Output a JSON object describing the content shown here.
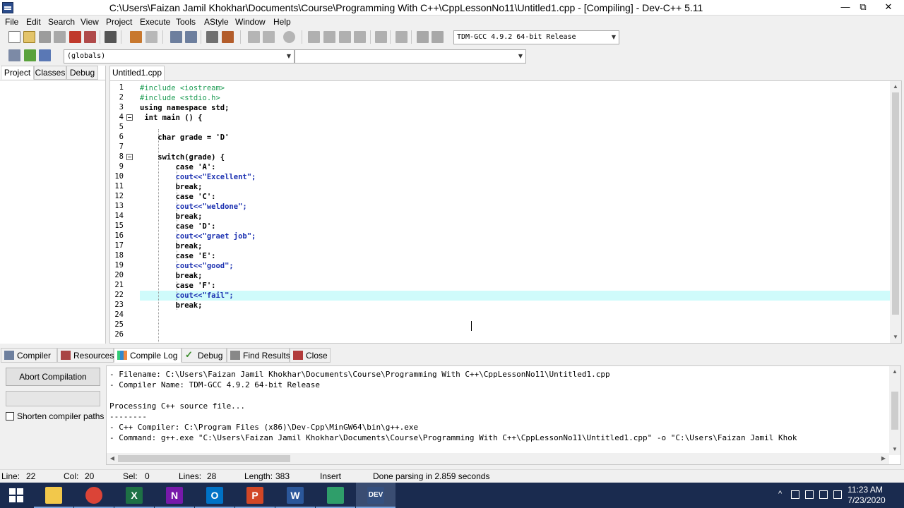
{
  "window": {
    "title": "C:\\Users\\Faizan Jamil Khokhar\\Documents\\Course\\Programming With C++\\CppLessonNo11\\Untitled1.cpp - [Compiling] - Dev-C++ 5.11",
    "minimize": "—",
    "maximize": "⧉",
    "close": "✕"
  },
  "menu": [
    "File",
    "Edit",
    "Search",
    "View",
    "Project",
    "Execute",
    "Tools",
    "AStyle",
    "Window",
    "Help"
  ],
  "toolbar": {
    "compiler_select": "TDM-GCC 4.9.2 64-bit Release",
    "scope_select": "(globals)",
    "member_select": ""
  },
  "left_panel": {
    "tabs": [
      "Project",
      "Classes",
      "Debug"
    ],
    "active_tab": "Project"
  },
  "editor": {
    "tab_label": "Untitled1.cpp",
    "line_numbers": [
      "1",
      "2",
      "3",
      "4",
      "5",
      "6",
      "7",
      "8",
      "9",
      "10",
      "11",
      "12",
      "13",
      "14",
      "15",
      "16",
      "17",
      "18",
      "19",
      "20",
      "21",
      "22",
      "23",
      "24",
      "25",
      "26"
    ],
    "lines": [
      "#include <iostream>",
      "#include <stdio.h>",
      "using namespace std;",
      " int main () {",
      "",
      "    char grade = 'D'",
      "",
      "    switch(grade) {",
      "        case 'A':",
      "        cout<<\"Excellent\";",
      "        break;",
      "        case 'C':",
      "        cout<<\"weldone\";",
      "        break;",
      "        case 'D':",
      "        cout<<\"graet job\";",
      "        break;",
      "        case 'E':",
      "        cout<<\"good\";",
      "        break;",
      "        case 'F':",
      "        cout<<\"fail\";",
      "        break;",
      "",
      "",
      ""
    ]
  },
  "bottom_tabs": [
    "Compiler",
    "Resources",
    "Compile Log",
    "Debug",
    "Find Results",
    "Close"
  ],
  "active_bottom_tab": "Compile Log",
  "compile_panel": {
    "abort_label": "Abort Compilation",
    "shorten_label": "Shorten compiler paths",
    "shorten_checked": false,
    "log": [
      "- Filename: C:\\Users\\Faizan Jamil Khokhar\\Documents\\Course\\Programming With C++\\CppLessonNo11\\Untitled1.cpp",
      "- Compiler Name: TDM-GCC 4.9.2 64-bit Release",
      "",
      "Processing C++ source file...",
      "--------",
      "- C++ Compiler: C:\\Program Files (x86)\\Dev-Cpp\\MinGW64\\bin\\g++.exe",
      "- Command: g++.exe \"C:\\Users\\Faizan Jamil Khokhar\\Documents\\Course\\Programming With C++\\CppLessonNo11\\Untitled1.cpp\" -o \"C:\\Users\\Faizan Jamil Khok"
    ]
  },
  "status": {
    "line_label": "Line:",
    "line_value": "22",
    "col_label": "Col:",
    "col_value": "20",
    "sel_label": "Sel:",
    "sel_value": "0",
    "lines_label": "Lines:",
    "lines_value": "28",
    "length_label": "Length:",
    "length_value": "383",
    "mode": "Insert",
    "message": "Done parsing in 2.859 seconds"
  },
  "taskbar": {
    "apps": [
      {
        "name": "file-explorer",
        "glyph": "",
        "color": "#f2c84b"
      },
      {
        "name": "chrome",
        "glyph": "",
        "color": "#db4437"
      },
      {
        "name": "excel",
        "glyph": "X",
        "color": "#1e7145"
      },
      {
        "name": "onenote",
        "glyph": "N",
        "color": "#7719aa"
      },
      {
        "name": "outlook",
        "glyph": "O",
        "color": "#0072c6"
      },
      {
        "name": "powerpoint",
        "glyph": "P",
        "color": "#d24726"
      },
      {
        "name": "word",
        "glyph": "W",
        "color": "#2b579a"
      },
      {
        "name": "app-green",
        "glyph": "",
        "color": "#2f9e6a"
      },
      {
        "name": "dev-cpp",
        "glyph": "DEV",
        "color": "#35507f"
      }
    ],
    "time": "11:23 AM",
    "date": "7/23/2020"
  }
}
